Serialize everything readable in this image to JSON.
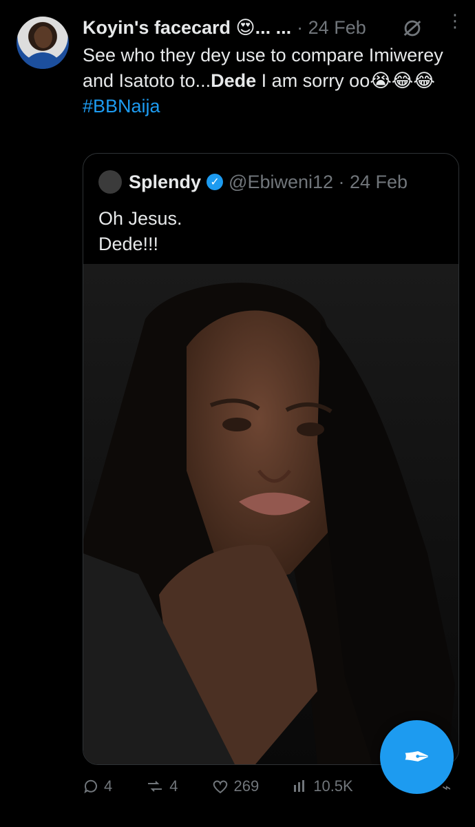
{
  "tweet": {
    "author": "Koyin's facecard 😍... ...",
    "time": "· 24 Feb",
    "text_plain": "See who they dey use to compare Imiwerey and Isatoto to...",
    "text_bold": "Dede",
    "text_tail": " I am sorry oo😭😂😂",
    "hashtag": "#BBNaija"
  },
  "quote": {
    "name": "Splendy",
    "handle": "@Ebiweni12 · 24 Feb",
    "line1": "Oh Jesus.",
    "line2": "Dede!!!"
  },
  "stats": {
    "replies": "4",
    "reposts": "4",
    "likes": "269",
    "views": "10.5K"
  },
  "icons": {
    "reply": "reply-icon",
    "repost": "repost-icon",
    "like": "heart-icon",
    "views": "views-icon",
    "more": "more-icon",
    "grok": "grok-icon",
    "fab": "compose-icon"
  },
  "colors": {
    "accent": "#1d9bf0",
    "text": "#e7e9ea",
    "muted": "#71767b"
  }
}
